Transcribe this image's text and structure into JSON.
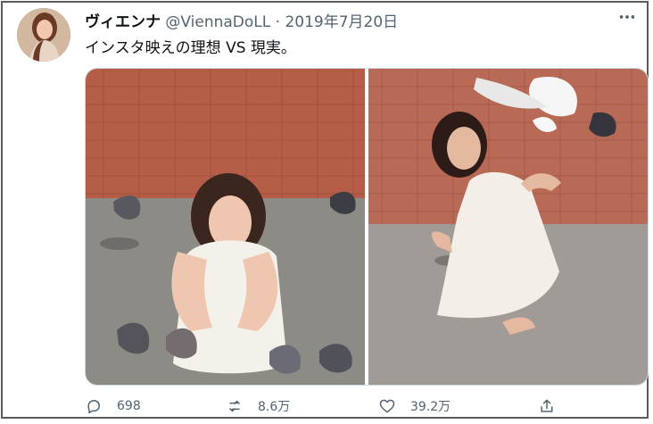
{
  "tweet": {
    "author_name": "ヴィエンナ",
    "author_handle": "@ViennaDoLL",
    "separator": "·",
    "date": "2019年7月20日",
    "text": "インスタ映えの理想 VS 現実。"
  },
  "actions": {
    "replies": "698",
    "retweets": "8.6万",
    "likes": "39.2万"
  },
  "icons": {
    "more": "more-icon",
    "reply": "reply-icon",
    "retweet": "retweet-icon",
    "like": "heart-icon",
    "share": "share-icon"
  },
  "colors": {
    "text": "#0f1419",
    "muted": "#536471",
    "border": "#cfd9de"
  }
}
